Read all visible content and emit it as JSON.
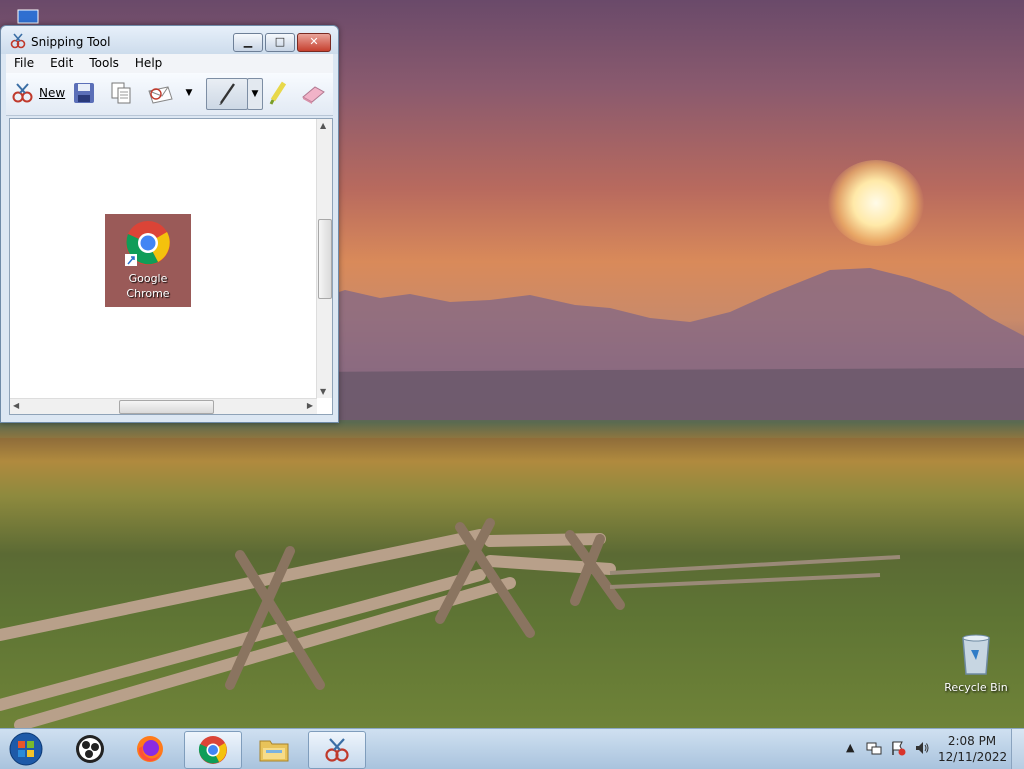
{
  "window": {
    "title": "Snipping Tool",
    "controls": {
      "minimize": "▁",
      "maximize": "□",
      "close": "✕"
    }
  },
  "menu": [
    "File",
    "Edit",
    "Tools",
    "Help"
  ],
  "toolbar": {
    "new_label": "New",
    "icons": [
      "new-snip-icon",
      "save-icon",
      "copy-icon",
      "send-email-icon",
      "pen-icon",
      "highlighter-icon",
      "eraser-icon"
    ]
  },
  "captured_snip": {
    "label_line1": "Google",
    "label_line2": "Chrome",
    "background": "#9a5a58"
  },
  "desktop": {
    "recycle_bin_label": "Recycle Bin"
  },
  "taskbar": {
    "apps": [
      "start-orb-icon",
      "obs-icon",
      "firefox-icon",
      "chrome-icon",
      "file-explorer-icon",
      "snipping-tool-icon"
    ],
    "active_app": "snipping-tool-icon"
  },
  "tray": {
    "time": "2:08 PM",
    "date": "12/11/2022",
    "icons": [
      "show-hidden-icons-icon",
      "network-icon",
      "action-center-icon",
      "volume-icon"
    ]
  },
  "colors": {
    "taskbar": "#b9d0e8",
    "window_frame": "#dce7f3",
    "close_button": "#c6402f"
  }
}
